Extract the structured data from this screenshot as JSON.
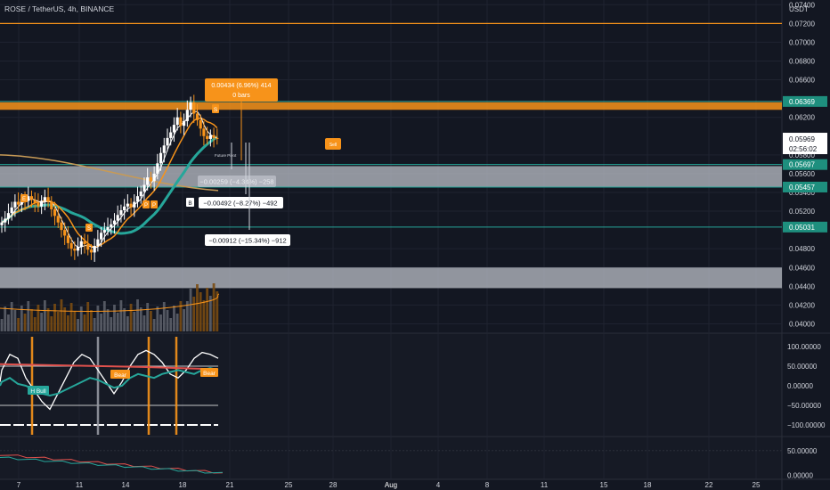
{
  "header": {
    "title": "ROSE / TetherUS, 4h, BINANCE",
    "currency": "USDT"
  },
  "colors": {
    "background": "#131722",
    "accent_orange": "#f7931a",
    "teal": "#26a69a",
    "price_label_teal": "#1e8f7e",
    "grid": "#1f2330",
    "text": "#b2b5be"
  },
  "price_axis": {
    "labels": [
      "0.07400",
      "0.07200",
      "0.07000",
      "0.06800",
      "0.06600",
      "0.06200",
      "0.05800",
      "0.05600",
      "0.05400",
      "0.05200",
      "0.04800",
      "0.04600",
      "0.04400",
      "0.04200",
      "0.04000"
    ],
    "highlighted": [
      {
        "text": "0.06369",
        "kind": "teal",
        "value": 0.06369
      },
      {
        "text": "0.05697",
        "kind": "teal",
        "value": 0.05697
      },
      {
        "text": "0.05457",
        "kind": "teal",
        "value": 0.05457
      },
      {
        "text": "0.05031",
        "kind": "teal",
        "value": 0.05031
      }
    ],
    "current": {
      "price": "0.05969",
      "countdown": "02:56:02",
      "value": 0.05969
    }
  },
  "levels": {
    "top_line": 0.072,
    "orange_band": [
      0.0628,
      0.0636
    ],
    "teal_lines": [
      0.06369,
      0.05697,
      0.05457,
      0.05031
    ],
    "gray_zones": [
      [
        0.05457,
        0.0568
      ],
      [
        0.0438,
        0.046
      ]
    ]
  },
  "oscillator_axis": {
    "labels": [
      "100.00000",
      "50.00000",
      "0.00000",
      "−50.00000",
      "−100.00000"
    ],
    "values": [
      100,
      50,
      0,
      -50,
      -100
    ]
  },
  "bottom_axis": {
    "labels": [
      "50.00000",
      "0.00000"
    ],
    "values": [
      50,
      0
    ]
  },
  "time_axis": {
    "labels": [
      "7",
      "11",
      "14",
      "18",
      "21",
      "25",
      "28",
      "Aug",
      "4",
      "8",
      "11",
      "15",
      "18",
      "22",
      "25"
    ]
  },
  "annotations": {
    "measure_top": "0.00434 (6.96%) 414",
    "measure_top_sub": "0 bars",
    "measure_1": "−0.00259 (−4.34%) −258",
    "measure_2": "−0.00492 (−8.27%) −492",
    "measure_3": "−0.00912 (−15.34%) −912",
    "small_note": "Future Pivot",
    "orange_tag": "Sell",
    "bull_label": "H Bull",
    "bear_label_1": "Bear",
    "bear_label_2": "Bear",
    "marker_s": "S",
    "marker_b": "B",
    "marker_p": "P",
    "marker_e": "E"
  },
  "chart_data": {
    "type": "line",
    "title": "ROSE / TetherUS, 4h, BINANCE",
    "xlabel": "",
    "ylabel": "",
    "ylim": [
      0.039,
      0.0745
    ],
    "note_axis": "price in USDT",
    "series": [
      {
        "name": "",
        "x": [
          0,
          2,
          4,
          6,
          8,
          10,
          12,
          14,
          16,
          18,
          20,
          22,
          24,
          26,
          28,
          30,
          32,
          34,
          36,
          38,
          40,
          42,
          44,
          46,
          48,
          50,
          52,
          54,
          56,
          58,
          60,
          62,
          64,
          66,
          68,
          70,
          72,
          74,
          76,
          78,
          80,
          82,
          84,
          86,
          88,
          90,
          92,
          94,
          96,
          98,
          100,
          102,
          104,
          106,
          108,
          110,
          112,
          114,
          116,
          118,
          120,
          122,
          124,
          126,
          128,
          130
        ],
        "close": [
          0.0508,
          0.0512,
          0.0518,
          0.0524,
          0.053,
          0.0527,
          0.0533,
          0.0531,
          0.0536,
          0.0532,
          0.0529,
          0.0525,
          0.0531,
          0.0535,
          0.053,
          0.0522,
          0.0515,
          0.0508,
          0.05,
          0.0494,
          0.0486,
          0.048,
          0.0478,
          0.0482,
          0.0488,
          0.0485,
          0.0479,
          0.0476,
          0.0483,
          0.049,
          0.0497,
          0.05,
          0.0503,
          0.0506,
          0.051,
          0.0516,
          0.0521,
          0.0525,
          0.0528,
          0.0524,
          0.053,
          0.0536,
          0.0541,
          0.0548,
          0.0556,
          0.0552,
          0.056,
          0.0571,
          0.0582,
          0.059,
          0.0598,
          0.0604,
          0.0612,
          0.062,
          0.0611,
          0.0616,
          0.0628,
          0.0636,
          0.0624,
          0.0617,
          0.0608,
          0.06,
          0.0597,
          0.0601,
          0.0598,
          0.0597
        ]
      }
    ]
  }
}
